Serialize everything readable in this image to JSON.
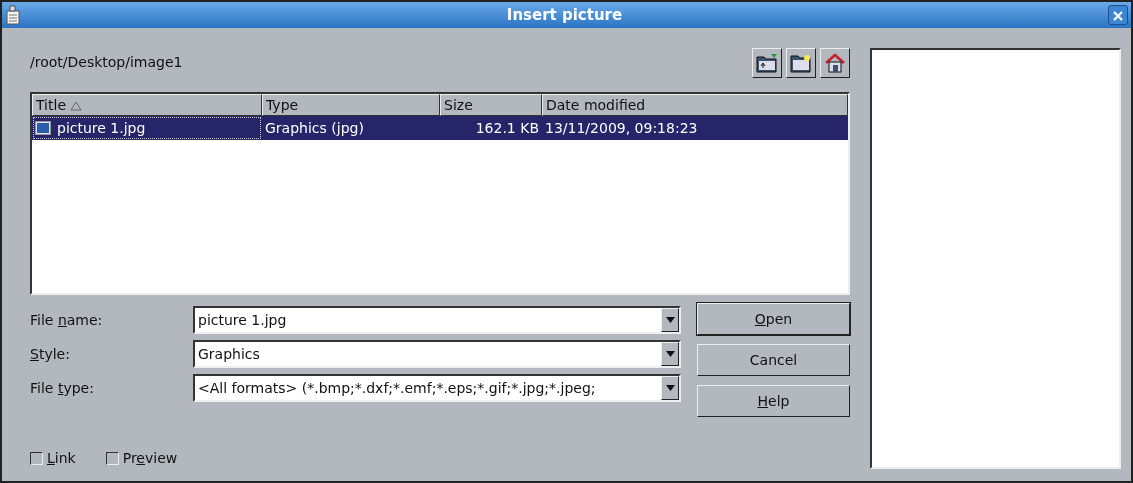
{
  "window": {
    "title": "Insert picture"
  },
  "path": "/root/Desktop/image1",
  "toolbar": [
    {
      "kind": "up"
    },
    {
      "kind": "new-folder"
    },
    {
      "kind": "home"
    }
  ],
  "table": {
    "columns": [
      {
        "label": "Title",
        "sorted": true
      },
      {
        "label": "Type",
        "sorted": false
      },
      {
        "label": "Size",
        "sorted": false
      },
      {
        "label": "Date modified",
        "sorted": false
      }
    ],
    "rows": [
      {
        "selected": true,
        "cells": [
          "picture 1.jpg",
          "Graphics (jpg)",
          "162.1 KB",
          "13/11/2009, 09:18:23"
        ]
      }
    ]
  },
  "fields": [
    {
      "label_before": "File ",
      "access_key": "n",
      "label_after": "ame:",
      "value": "picture 1.jpg"
    },
    {
      "access_key": "S",
      "label_after": "tyle:",
      "value": "Graphics"
    },
    {
      "label_before": "File ",
      "access_key": "t",
      "label_after": "ype:",
      "value": "<All formats> (*.bmp;*.dxf;*.emf;*.eps;*.gif;*.jpg;*.jpeg;"
    }
  ],
  "buttons": [
    {
      "access_key": "O",
      "label_after": "pen",
      "default": true
    },
    {
      "label_after": "Cancel",
      "default": false
    },
    {
      "access_key": "H",
      "label_after": "elp",
      "default": false
    }
  ],
  "checkboxes": [
    {
      "access_key": "L",
      "label_after": "ink",
      "checked": false
    },
    {
      "label_before": "Pr",
      "access_key": "e",
      "label_after": "view",
      "checked": false
    }
  ]
}
